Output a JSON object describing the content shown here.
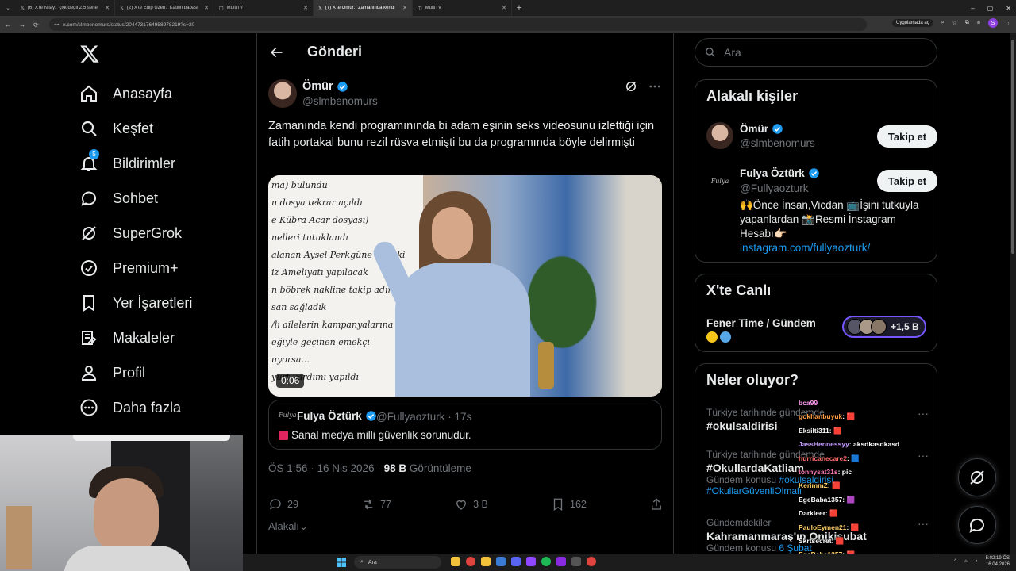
{
  "browser": {
    "tabs": [
      {
        "label": "(6) X'te Nilay: \"çok değil 2.5 sene",
        "active": false
      },
      {
        "label": "(2) X'te Edip Üzeri: \"Katilin babası",
        "active": false
      },
      {
        "label": "MultiTV",
        "active": false
      },
      {
        "label": "(7) X'te Ömür: \"Zamanında kendi",
        "active": true
      },
      {
        "label": "MultiTV",
        "active": false
      }
    ],
    "url": "x.com/slmbenomurs/status/2044731764958978219?s=20",
    "app_pill": "Uygulamada aç"
  },
  "nav": {
    "items": [
      {
        "label": "Anasayfa",
        "icon": "home-icon"
      },
      {
        "label": "Keşfet",
        "icon": "search-icon"
      },
      {
        "label": "Bildirimler",
        "icon": "bell-icon",
        "badge": "5"
      },
      {
        "label": "Sohbet",
        "icon": "chat-icon"
      },
      {
        "label": "SuperGrok",
        "icon": "grok-icon"
      },
      {
        "label": "Premium+",
        "icon": "verified-icon"
      },
      {
        "label": "Yer İşaretleri",
        "icon": "bookmark-icon"
      },
      {
        "label": "Makaleler",
        "icon": "article-icon"
      },
      {
        "label": "Profil",
        "icon": "person-icon"
      },
      {
        "label": "Daha fazla",
        "icon": "more-circle-icon"
      }
    ]
  },
  "header": {
    "title": "Gönderi"
  },
  "post": {
    "author_name": "Ömür",
    "author_handle": "@slmbenomurs",
    "text": "Zamanında kendi programınında bi adam eşinin seks  videosunu izlettiği için fatih portakal bunu rezil rüsva etmişti bu da programında böyle delirmişti",
    "video_duration": "0:06",
    "video_board_lines": [
      "ma) bulundu",
      "n dosya tekrar açıldı",
      "e Kübra Acar dosyası)",
      "nelleri tutuklandı",
      "alanan Aysel Perkgüne hukuki",
      "iz Ameliyatı yapılacak",
      "n böbrek nakline takip adır",
      "san sağladık",
      "/lı ailelerin kampanyalarına destek verildi",
      "eğiyle geçinen emekçi",
      "uyorsa...",
      "yurt yardımı yapıldı"
    ],
    "quote": {
      "logo_text": "Fulya",
      "name": "Fulya Öztürk",
      "handle_time": "@Fullyaozturk · 17s",
      "text": "Sanal medya milli güvenlik sorunudur."
    },
    "time": "ÖS 1:56 · 16 Nis 2026 · ",
    "views_count": "98 B",
    "views_label": " Görüntüleme",
    "actions": {
      "replies": "29",
      "reposts": "77",
      "likes": "3 B",
      "bookmarks": "162"
    },
    "related_label": "Alakalı"
  },
  "search": {
    "placeholder": "Ara"
  },
  "related_people": {
    "title": "Alakalı kişiler",
    "people": [
      {
        "name": "Ömür",
        "handle": "@slmbenomurs",
        "button": "Takip et"
      },
      {
        "name": "Fulya Öztürk",
        "handle": "@Fullyaozturk",
        "button": "Takip et",
        "logo_text": "Fulya",
        "bio": "🙌Önce İnsan,Vicdan 📺İşini tutkuyla yapanlardan 📸Resmi İnstagram Hesabı👉🏻",
        "link": "instagram.com/fullyaozturk/"
      }
    ]
  },
  "live": {
    "title": "X'te Canlı",
    "space_name": "Fener Time / Gündem",
    "listeners": "+1,5 B"
  },
  "trends": {
    "title": "Neler oluyor?",
    "items": [
      {
        "category": "Türkiye tarihinde gündemde",
        "name": "#okulsaldirisi",
        "sub": ""
      },
      {
        "category": "Türkiye tarihinde gündemde",
        "name": "#OkullardaKatliam",
        "sub_prefix": "Gündem konusu ",
        "sub_hl": "#okulsaldirisi",
        "sub2": "#OkullarGüvenliOlmalı"
      },
      {
        "category": "Gündemdekiler",
        "name": "Kahramanmaraş'ın Onikişubat",
        "sub_prefix": "Gündem konusu ",
        "sub_hl": "6 Şubat"
      }
    ]
  },
  "chat": [
    {
      "name": "bca99",
      "msg": "",
      "color": "#ff9cf0"
    },
    {
      "name": "gokhanbuyuk",
      "msg": ": 🟥",
      "color": "#ff9f43"
    },
    {
      "name": "Eksilti311",
      "msg": ": 🟥",
      "color": "#ffffff"
    },
    {
      "name": "JassHennessyy",
      "msg": ": aksdkasdkasd",
      "color": "#c39bff"
    },
    {
      "name": "hurricanecare2",
      "msg": ": 🟦",
      "color": "#ff6b6b"
    },
    {
      "name": "tonnysat31s",
      "msg": ": pic",
      "color": "#ff7ab8"
    },
    {
      "name": "KerimmZ",
      "msg": ": 🟥",
      "color": "#ffd166"
    },
    {
      "name": "EgeBaba1357",
      "msg": ": 🟪",
      "color": "#ffffff"
    },
    {
      "name": "Darkleer",
      "msg": ": 🟥",
      "color": "#ffffff"
    },
    {
      "name": "PauloEymen21",
      "msg": ": 🟥",
      "color": "#ffd166"
    },
    {
      "name": "Skrtsecret",
      "msg": ": 🟥",
      "color": "#ffffff"
    },
    {
      "name": "EgeBaba1357",
      "msg": ": 🟥",
      "color": "#ffd166"
    }
  ],
  "taskbar": {
    "search_label": "Ara",
    "clock_time": "5:02:19 ÖS",
    "clock_date": "16.04.2026"
  },
  "colors": {
    "accent": "#1d9bf0",
    "background": "#000000",
    "border": "#2f3336",
    "muted": "#71767b"
  }
}
